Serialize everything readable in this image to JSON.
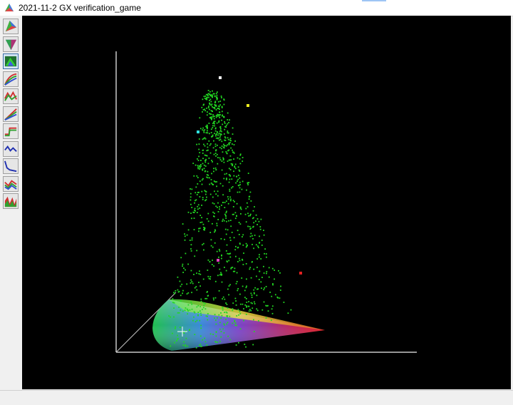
{
  "window": {
    "title": "2021-11-2 GX verification_game",
    "accent_color": "#9ec5f5"
  },
  "toolbar": {
    "tools": [
      {
        "icon": "chromaticity-2d-icon",
        "active": false
      },
      {
        "icon": "chromaticity-cone-icon",
        "active": false
      },
      {
        "icon": "gamut-3d-view-icon",
        "active": true
      },
      {
        "icon": "rgb-curves-icon",
        "active": false
      },
      {
        "icon": "spectrum-icon",
        "active": false
      },
      {
        "icon": "tone-curve-icon",
        "active": false
      },
      {
        "icon": "step-response-icon",
        "active": false
      },
      {
        "icon": "blue-line-graph-icon",
        "active": false
      },
      {
        "icon": "falloff-graph-icon",
        "active": false
      },
      {
        "icon": "rgb-line-graph-icon",
        "active": false
      },
      {
        "icon": "rgb-area-graph-icon",
        "active": false
      }
    ]
  },
  "viewport": {
    "background": "#000000",
    "axis_color": "#c8c8c8",
    "point_color": "#22d822",
    "primary_markers": [
      {
        "name": "white",
        "color": "#ffffff"
      },
      {
        "name": "yellow",
        "color": "#f0f020"
      },
      {
        "name": "cyan",
        "color": "#30e0e0"
      },
      {
        "name": "magenta",
        "color": "#e040c0"
      },
      {
        "name": "red",
        "color": "#e02020"
      }
    ]
  }
}
